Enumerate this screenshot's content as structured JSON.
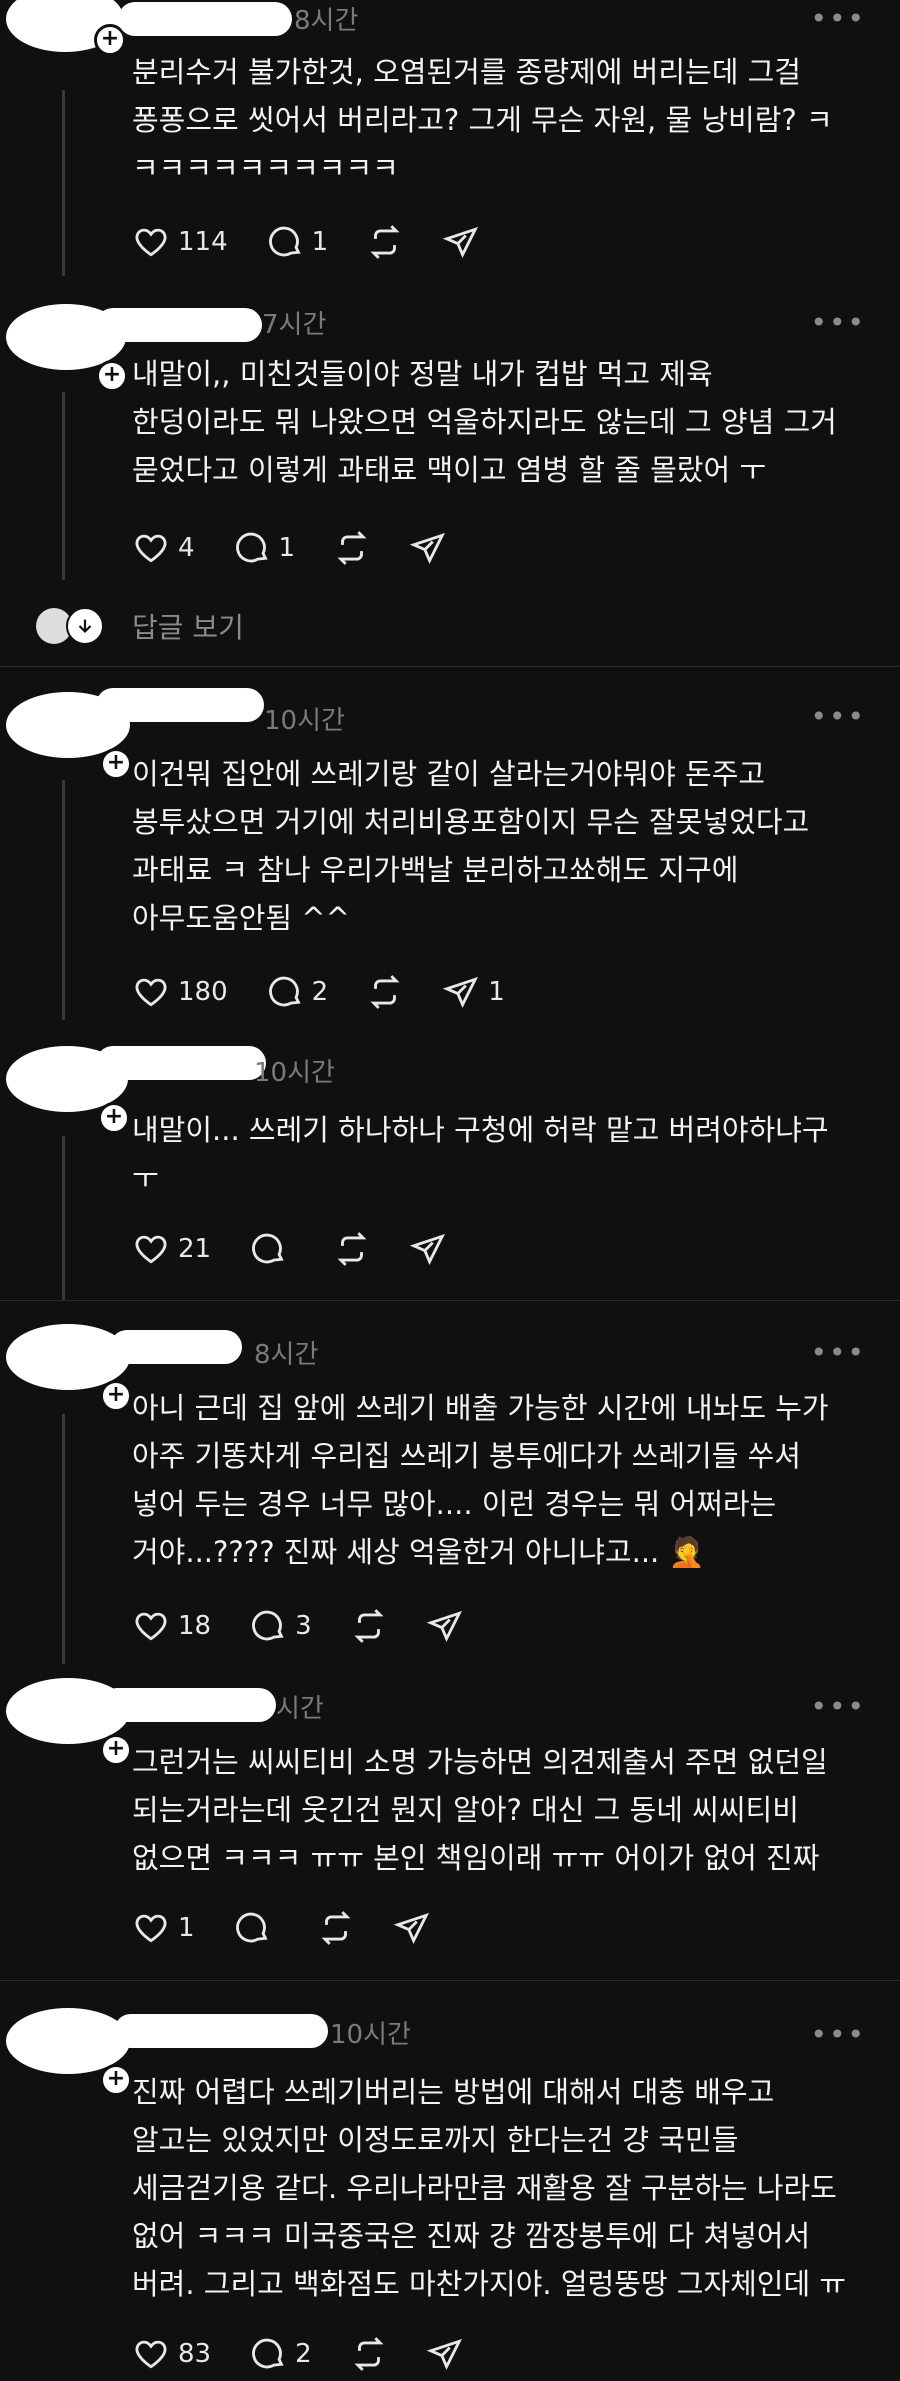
{
  "posts": [
    {
      "time": "8시간",
      "text": "분리수거 불가한것, 오염된거를 종량제에 버리는데 그걸\n퐁퐁으로 씻어서 버리라고? 그게 무슨 자원, 물 낭비람? ㅋ\nㅋㅋㅋㅋㅋㅋㅋㅋㅋㅋ",
      "likes": "114",
      "comments": "1",
      "shares": ""
    },
    {
      "time": "7시간",
      "text": "내말이,, 미친것들이야 정말 내가 컵밥 먹고 제육\n한덩이라도 뭐 나왔으면 억울하지라도 않는데 그 양념 그거\n묻었다고 이렇게 과태료 맥이고 염병 할 줄 몰랐어 ㅜ",
      "likes": "4",
      "comments": "1",
      "shares": ""
    },
    {
      "time": "10시간",
      "text": "이건뭐 집안에 쓰레기랑 같이 살라는거야뭐야 돈주고\n봉투샀으면 거기에 처리비용포함이지 무슨 잘못넣었다고\n과태료 ㅋ 참나 우리가백날 분리하고쑈해도 지구에\n아무도움안됨 ^^",
      "likes": "180",
      "comments": "2",
      "shares": "1"
    },
    {
      "time": "10시간",
      "text": "내말이... 쓰레기 하나하나 구청에 허락 맡고 버려야하냐구\nㅜ",
      "likes": "21",
      "comments": "",
      "shares": ""
    },
    {
      "time": "8시간",
      "text": "아니 근데 집 앞에 쓰레기 배출 가능한 시간에 내놔도 누가\n아주 기똥차게 우리집 쓰레기 봉투에다가 쓰레기들 쑤셔\n넣어 두는 경우 너무 많아.... 이런 경우는 뭐 어쩌라는\n거야...???? 진짜 세상 억울한거 아니냐고... 🤦",
      "likes": "18",
      "comments": "3",
      "shares": ""
    },
    {
      "time": "시간",
      "text": "그런거는 씨씨티비 소명 가능하면 의견제출서 주면 없던일\n되는거라는데 웃긴건 뭔지 알아? 대신 그 동네 씨씨티비\n없으면 ㅋㅋㅋ ㅠㅠ 본인 책임이래 ㅠㅠ 어이가 없어 진짜",
      "likes": "1",
      "comments": "",
      "shares": ""
    },
    {
      "time": "10시간",
      "text": "진짜 어렵다 쓰레기버리는 방법에 대해서 대충 배우고\n알고는 있었지만 이정도로까지 한다는건 걍 국민들\n세금걷기용 같다. 우리나라만큼 재활용 잘 구분하는 나라도\n없어 ㅋㅋㅋ 미국중국은 진짜 걍 깜장봉투에 다 쳐넣어서\n버려. 그리고 백화점도 마찬가지야. 얼렁뚱땅 그자체인데 ㅠ",
      "likes": "83",
      "comments": "2",
      "shares": ""
    }
  ],
  "more_label": "•••",
  "view_replies": "답글 보기"
}
